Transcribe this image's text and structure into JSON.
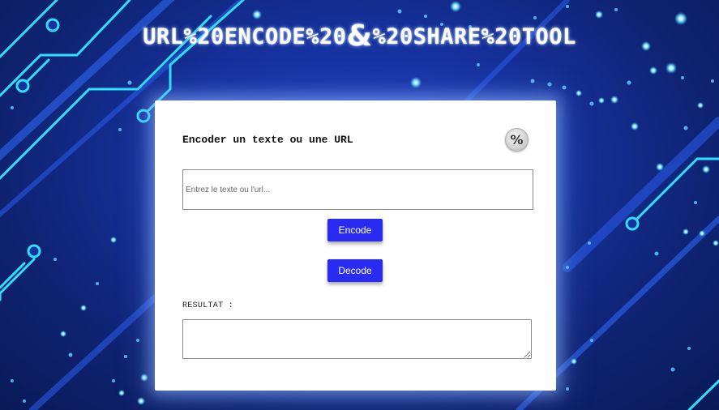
{
  "header": {
    "title_part1": "URL%20ENCODE%20",
    "title_amp": "&",
    "title_part2": "%20SHARE%20TOOL"
  },
  "card": {
    "heading": "Encoder un texte ou une URL",
    "percent_button_label": "%",
    "input_placeholder": "Entrez le texte ou l'url...",
    "input_value": "",
    "encode_label": "Encode",
    "decode_label": "Decode",
    "result_label": "RESULTAT :",
    "result_value": ""
  },
  "colors": {
    "button_blue": "#2a2bf0",
    "background_blue": "#1632a0",
    "circuit_cyan": "#2ee0ff"
  }
}
